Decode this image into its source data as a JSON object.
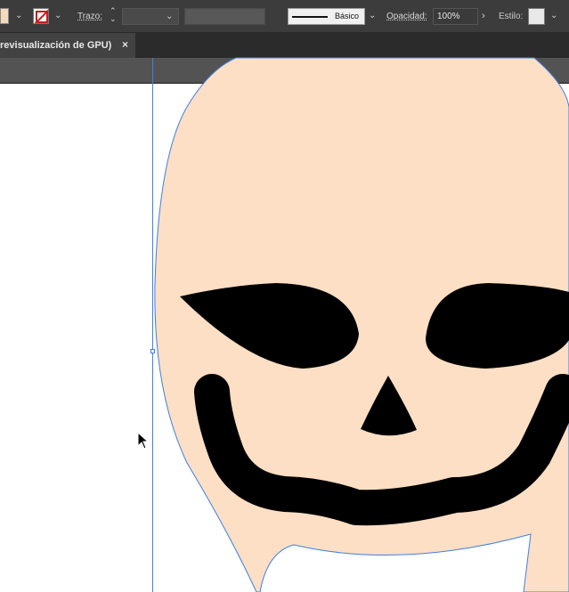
{
  "control_bar": {
    "stroke_label": "Trazo:",
    "stroke_weight": "",
    "brush_profile_label": "Básico",
    "opacity_label": "Opacidad:",
    "opacity_value": "100%",
    "style_label": "Estilo:",
    "fill_color": "#f5d9bd",
    "style_color": "#e9e9e9"
  },
  "document_tab": {
    "title": "revisualización de GPU)",
    "close_glyph": "×"
  },
  "artwork": {
    "skull_fill": "#fcdfc4",
    "feature_color": "#000000",
    "path_highlight": "#3d7fe6"
  },
  "icons": [
    "fill-swatch-icon",
    "stroke-none-icon",
    "chevron-down-icon",
    "stepper-icon",
    "chevron-right-icon",
    "close-icon",
    "arrow-cursor-icon"
  ]
}
